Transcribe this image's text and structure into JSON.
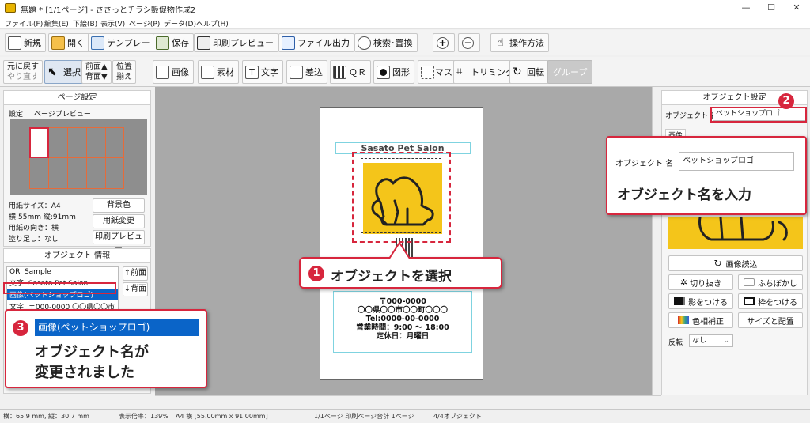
{
  "window": {
    "title": "無題 * [1/1ページ] - ささっとチラシ販促物作成2",
    "min_label": "—",
    "max_label": "☐",
    "close_label": "✕"
  },
  "menu": [
    "ファイル(F)",
    "編集(E)",
    "下絵(B)",
    "表示(V)",
    "ページ(P)",
    "データ(D)",
    "ヘルプ(H)"
  ],
  "toolbar1": {
    "new": "新規",
    "open": "開く",
    "template": "テンプレート",
    "save": "保存",
    "print_preview": "印刷プレビュー",
    "export": "ファイル出力",
    "find_replace": "検索･置換",
    "zoom_in": "+",
    "zoom_out": "−",
    "howto": "操作方法"
  },
  "toolbar2": {
    "undo": "元に戻す",
    "redo": "やり直す",
    "select": "選択",
    "front": "前面▲",
    "back": "背面▼",
    "align1": "位置",
    "align2": "揃え",
    "image": "画像",
    "material": "素材",
    "text": "文字",
    "merge": "差込",
    "qr": "ＱＲ",
    "shape": "図形",
    "mask": "マスク",
    "trim": "トリミング",
    "rotate": "回転",
    "group": "グループ"
  },
  "page_settings": {
    "header": "ページ設定",
    "tab_settings": "設定",
    "tab_preview": "ページプレビュー",
    "paper_size": "用紙サイズ：A4",
    "dims": "横:55mm 縦:91mm",
    "orientation": "用紙の向き：横",
    "bleed": "塗り足し：なし",
    "bg_color_btn": "背景色",
    "change_paper_btn": "用紙変更",
    "print_preview_btn": "印刷プレビュー"
  },
  "object_info": {
    "header": "オブジェクト 情報",
    "items": [
      "QR: Sample",
      "文字: Sasato Pet Salon",
      "画像(ペットショップロゴ)",
      "文字: 〒000-0000 〇〇県〇〇市"
    ],
    "front_btn": "↑前面",
    "back_btn": "↓背面"
  },
  "flyer": {
    "shop_name": "Sasato Pet Salon",
    "address_lines": [
      "〒000-0000",
      "〇〇県〇〇市〇〇町〇〇〇",
      "Tel:0000-00-0000",
      "営業時間：9:00 ～ 18:00",
      "定休日：月曜日"
    ]
  },
  "object_settings": {
    "header": "オブジェクト設定",
    "name_label": "オブジェクト 名",
    "name_value": "ペットショップロゴ",
    "tab_image": "画像",
    "load_image": "画像読込",
    "cutout": "切り抜き",
    "border_blur": "ふちぼかし",
    "shadow": "影をつける",
    "frame": "枠をつける",
    "color_adjust": "色相補正",
    "size_position": "サイズと配置",
    "flip_label": "反転",
    "flip_value": "なし"
  },
  "callouts": {
    "c1_num": "1",
    "c1_text": "オブジェクトを選択",
    "c2_num": "2",
    "c2_label": "オブジェクト 名",
    "c2_value": "ペットショップロゴ",
    "c2_text": "オブジェクト名を入力",
    "c3_num": "3",
    "c3_item": "画像(ペットショップロゴ)",
    "c3_text1": "オブジェクト名が",
    "c3_text2": "変更されました"
  },
  "status": {
    "coords": "横：65.9 mm, 縦：30.7 mm",
    "zoom": "表示倍率：139%",
    "paper": "A4 横 [55.00mm x 91.00mm]",
    "pages": "1/1ページ 印刷ページ合計 1ページ",
    "objects": "4/4オブジェクト"
  },
  "colors": {
    "accent_red": "#d7263d",
    "logo_yellow": "#f4c51a",
    "selection_blue": "#0a64c8"
  }
}
